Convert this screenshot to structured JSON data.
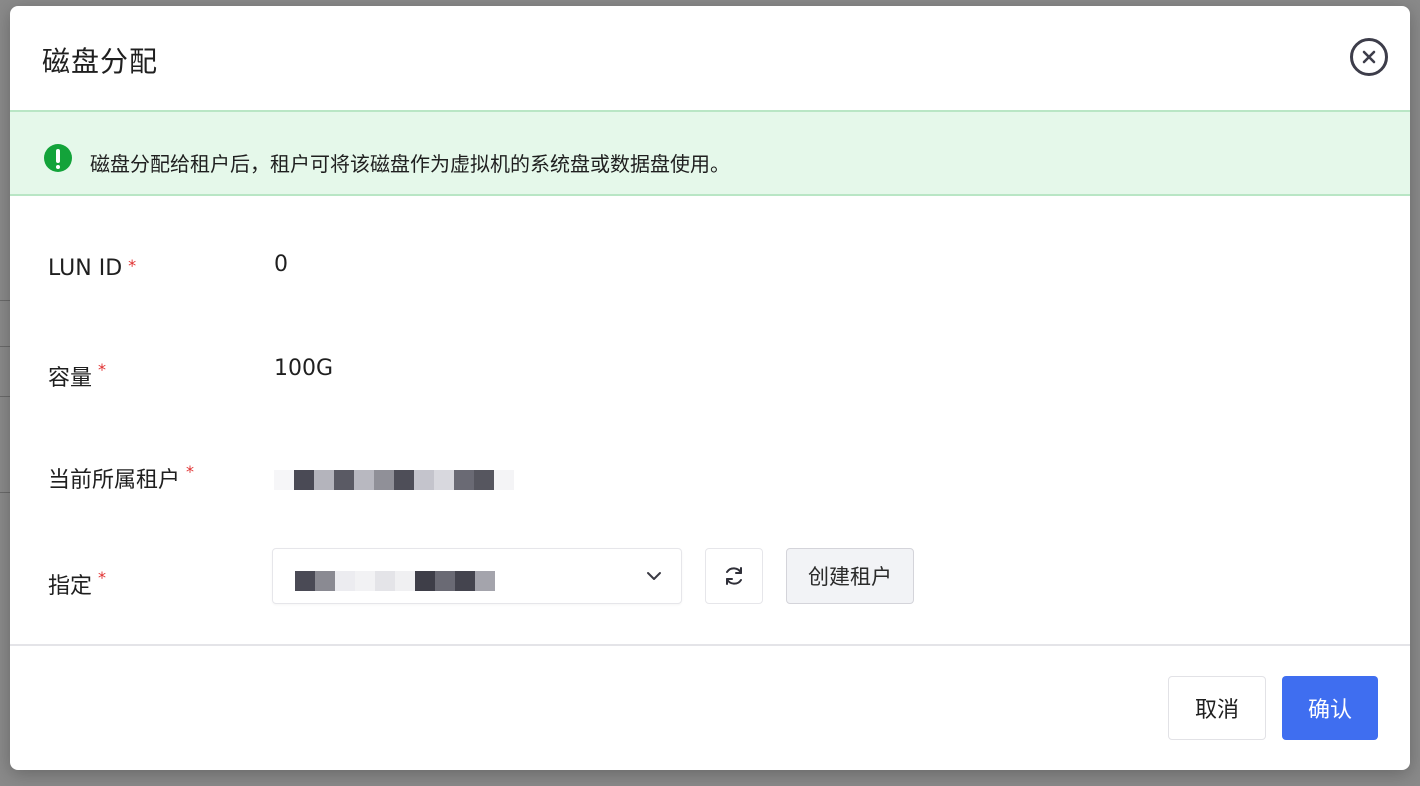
{
  "dialog": {
    "title": "磁盘分配",
    "close_icon": "close-circle-icon"
  },
  "alert": {
    "icon": "exclamation-circle-icon",
    "color": "#13a33a",
    "text": "磁盘分配给租户后，租户可将该磁盘作为虚拟机的系统盘或数据盘使用。"
  },
  "form": {
    "required_mark": "*",
    "lun_id": {
      "label": "LUN ID",
      "value": "0"
    },
    "capacity": {
      "label": "容量",
      "value": "100G"
    },
    "current_tenant": {
      "label": "当前所属租户",
      "value_redacted": true
    },
    "assign": {
      "label": "指定",
      "selected_redacted": true,
      "dropdown_icon": "chevron-down-icon",
      "refresh_icon": "refresh-icon",
      "create_tenant_label": "创建租户"
    }
  },
  "footer": {
    "cancel_label": "取消",
    "confirm_label": "确认",
    "confirm_color": "#3f6ef0"
  }
}
